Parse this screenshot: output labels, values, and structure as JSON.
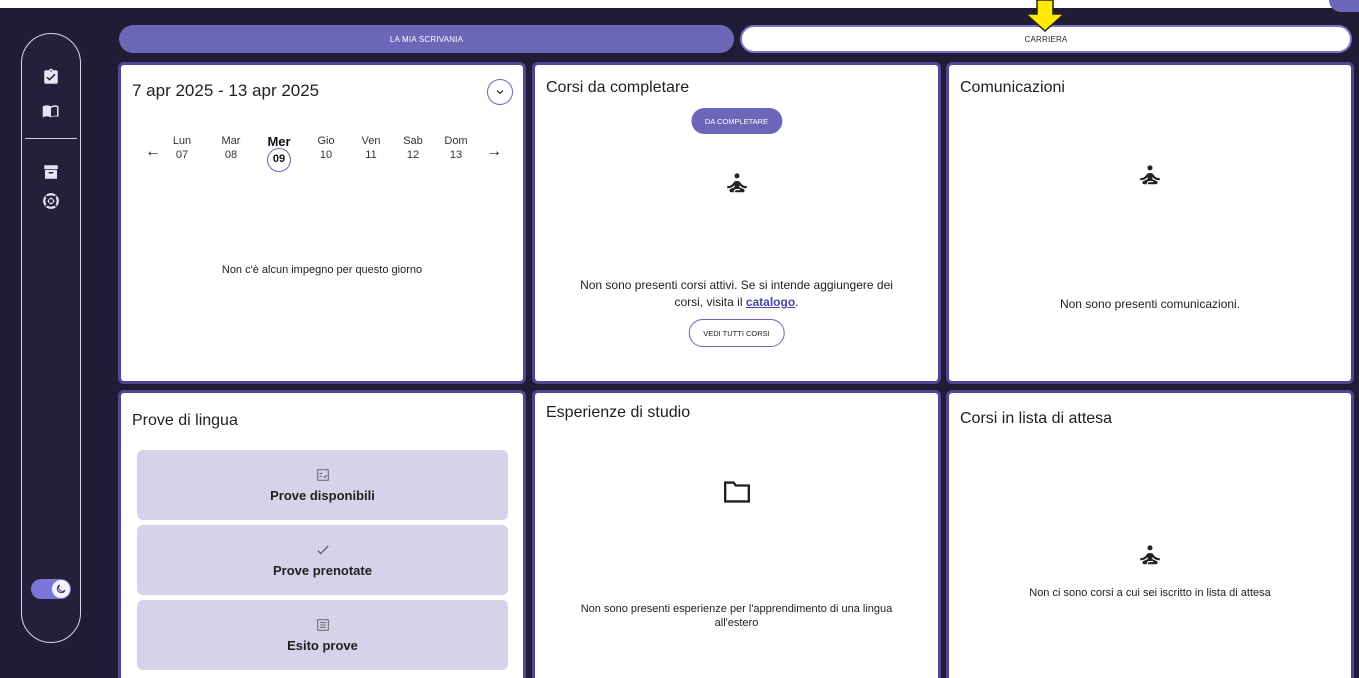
{
  "tabs": {
    "active": "LA MIA SCRIVANIA",
    "inactive": "CARRIERA"
  },
  "calendar": {
    "range": "7 apr 2025 - 13 apr 2025",
    "days": [
      {
        "name": "Lun",
        "num": "07"
      },
      {
        "name": "Mar",
        "num": "08"
      },
      {
        "name": "Mer",
        "num": "09"
      },
      {
        "name": "Gio",
        "num": "10"
      },
      {
        "name": "Ven",
        "num": "11"
      },
      {
        "name": "Sab",
        "num": "12"
      },
      {
        "name": "Dom",
        "num": "13"
      }
    ],
    "selected_day": "Mer",
    "empty": "Non c'è alcun impegno per questo giorno"
  },
  "corsi": {
    "title": "Corsi da completare",
    "badge": "DA COMPLETARE",
    "empty_before": "Non sono presenti corsi attivi. Se si intende aggiungere dei corsi, visita il",
    "link": "catalogo",
    "empty_after": ".",
    "button": "VEDI TUTTI CORSI"
  },
  "comunicazioni": {
    "title": "Comunicazioni",
    "empty": "Non sono presenti comunicazioni."
  },
  "prove": {
    "title": "Prove di lingua",
    "items": [
      {
        "label": "Prove disponibili",
        "icon": "checklist-icon"
      },
      {
        "label": "Prove prenotate",
        "icon": "check-icon"
      },
      {
        "label": "Esito prove",
        "icon": "list-icon"
      }
    ]
  },
  "esperienze": {
    "title": "Esperienze di studio",
    "empty": "Non sono presenti esperienze per l'apprendimento di una lingua all'estero"
  },
  "lista": {
    "title": "Corsi in lista di attesa",
    "empty": "Non ci sono corsi a cui sei iscritto in lista di attesa"
  },
  "colors": {
    "accent": "#6c66b8",
    "background": "#211c35",
    "item": "#d5d3ea",
    "arrow": "#ffeb00"
  }
}
